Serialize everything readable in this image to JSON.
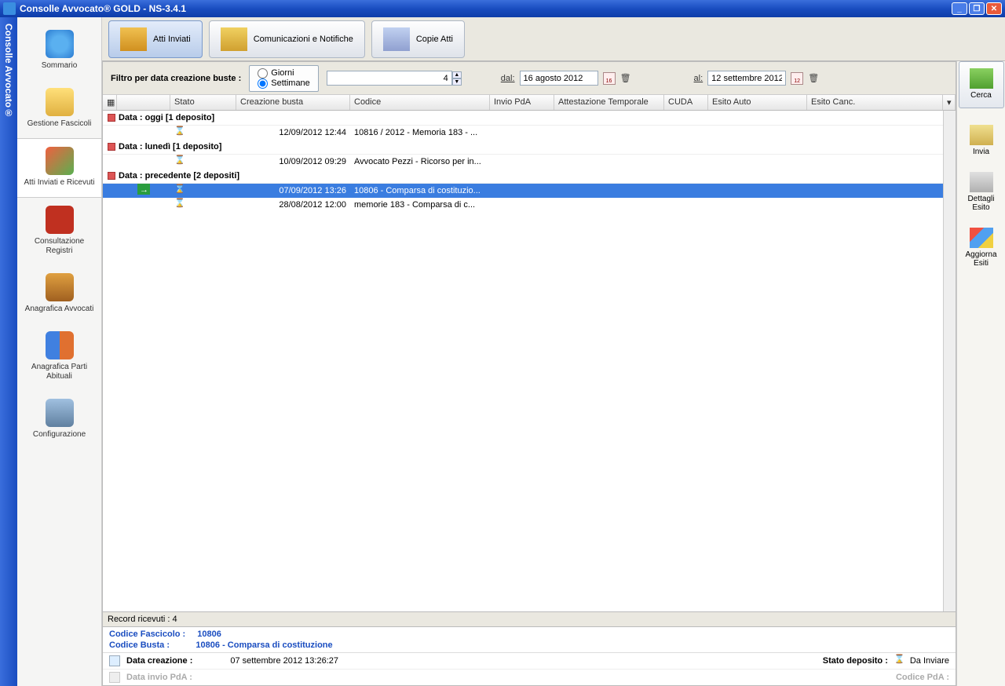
{
  "window": {
    "title": "Consolle Avvocato® GOLD - NS-3.4.1"
  },
  "vertbar": {
    "label": "Consolle Avvocato®"
  },
  "sidebar": {
    "items": [
      {
        "label": "Sommario"
      },
      {
        "label": "Gestione Fascicoli"
      },
      {
        "label": "Atti Inviati e Ricevuti"
      },
      {
        "label": "Consultazione Registri"
      },
      {
        "label": "Anagrafica Avvocati"
      },
      {
        "label": "Anagrafica Parti Abituali"
      },
      {
        "label": "Configurazione"
      }
    ]
  },
  "tabs": {
    "items": [
      {
        "label": "Atti Inviati"
      },
      {
        "label": "Comunicazioni e Notifiche"
      },
      {
        "label": "Copie Atti"
      }
    ]
  },
  "filter": {
    "label": "Filtro per data creazione buste :",
    "radio_giorni": "Giorni",
    "radio_settimane": "Settimane",
    "spin_value": "4",
    "dal_label": "dal:",
    "dal_value": "16 agosto 2012",
    "dal_day": "16",
    "al_label": "al:",
    "al_value": "12 settembre 2012",
    "al_day": "12"
  },
  "rightbar": {
    "cerca": "Cerca",
    "invia": "Invia",
    "dettagli": "Dettagli Esito",
    "aggiorna": "Aggiorna Esiti"
  },
  "grid": {
    "headers": {
      "stato": "Stato",
      "creazione": "Creazione busta",
      "codice": "Codice",
      "invio": "Invio PdA",
      "attest": "Attestazione Temporale",
      "cuda": "CUDA",
      "esito_auto": "Esito Auto",
      "esito_canc": "Esito Canc."
    },
    "groups": [
      {
        "label": "Data : oggi  [1 deposito]",
        "rows": [
          {
            "creazione": "12/09/2012 12:44",
            "codice": "10816 / 2012 - Memoria 183 - ..."
          }
        ]
      },
      {
        "label": "Data : lunedì  [1 deposito]",
        "rows": [
          {
            "creazione": "10/09/2012 09:29",
            "codice": "Avvocato Pezzi - Ricorso per in..."
          }
        ]
      },
      {
        "label": "Data : precedente  [2 depositi]",
        "rows": [
          {
            "creazione": "07/09/2012 13:26",
            "codice": "10806 - Comparsa di costituzio...",
            "selected": true,
            "badge": true
          },
          {
            "creazione": "28/08/2012 12:00",
            "codice": "memorie 183 - Comparsa di c..."
          }
        ]
      }
    ]
  },
  "status": {
    "record": "Record ricevuti : 4"
  },
  "details": {
    "fascicolo_k": "Codice Fascicolo :",
    "fascicolo_v": "10806",
    "busta_k": "Codice Busta :",
    "busta_v": "10806 - Comparsa di costituzione",
    "datacreaz_k": "Data creazione :",
    "datacreaz_v": "07 settembre 2012 13:26:27",
    "stato_k": "Stato deposito :",
    "stato_v": "Da Inviare",
    "datainvio_k": "Data invio PdA :",
    "codicepda_k": "Codice PdA :"
  }
}
